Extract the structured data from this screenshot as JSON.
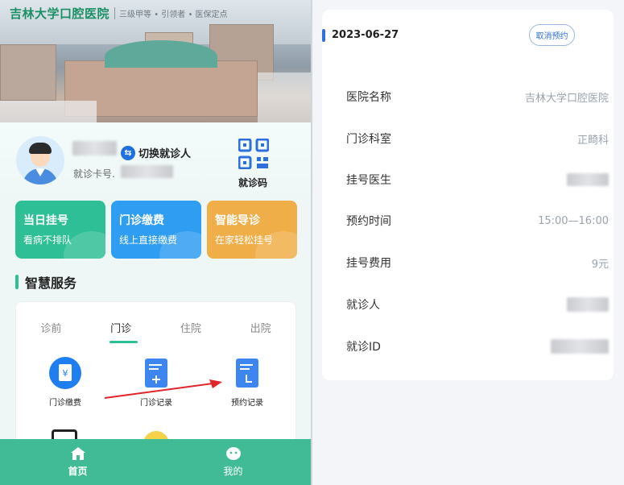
{
  "hospital": {
    "name": "吉林大学口腔医院",
    "subtitle": "三级甲等 • 引领者 • 医保定点"
  },
  "profile": {
    "switch_label": "切换就诊人",
    "switch_icon": "swap-icon",
    "card_label": "就诊卡号.",
    "qr_label": "就诊码"
  },
  "tiles": [
    {
      "title": "当日挂号",
      "subtitle": "看病不排队",
      "color": "#2fbf96"
    },
    {
      "title": "门诊缴费",
      "subtitle": "线上直接缴费",
      "color": "#2f9df2"
    },
    {
      "title": "智能导诊",
      "subtitle": "在家轻松挂号",
      "color": "#f0ae48"
    }
  ],
  "section_title": "智慧服务",
  "service_tabs": [
    "诊前",
    "门诊",
    "住院",
    "出院"
  ],
  "active_tab": "门诊",
  "services": [
    {
      "label": "门诊缴费",
      "icon": "payment-icon"
    },
    {
      "label": "门诊记录",
      "icon": "add-record-icon"
    },
    {
      "label": "预约记录",
      "icon": "appointment-record-icon"
    }
  ],
  "tabbar": [
    {
      "label": "首页",
      "icon": "home-icon",
      "active": true
    },
    {
      "label": "我的",
      "icon": "profile-icon",
      "active": false
    }
  ],
  "appointment": {
    "date": "2023-06-27",
    "cancel_label": "取消预约",
    "fields": [
      {
        "key": "医院名称",
        "value": "吉林大学口腔医院"
      },
      {
        "key": "门诊科室",
        "value": "正畸科"
      },
      {
        "key": "挂号医生",
        "value": ""
      },
      {
        "key": "预约时间",
        "value": "15:00—16:00"
      },
      {
        "key": "挂号费用",
        "value": "9元"
      },
      {
        "key": "就诊人",
        "value": ""
      },
      {
        "key": "就诊ID",
        "value": ""
      }
    ]
  },
  "colors": {
    "brand_green": "#41bb95",
    "accent_blue": "#2d6fdc",
    "annotation_red": "#e0262b"
  }
}
